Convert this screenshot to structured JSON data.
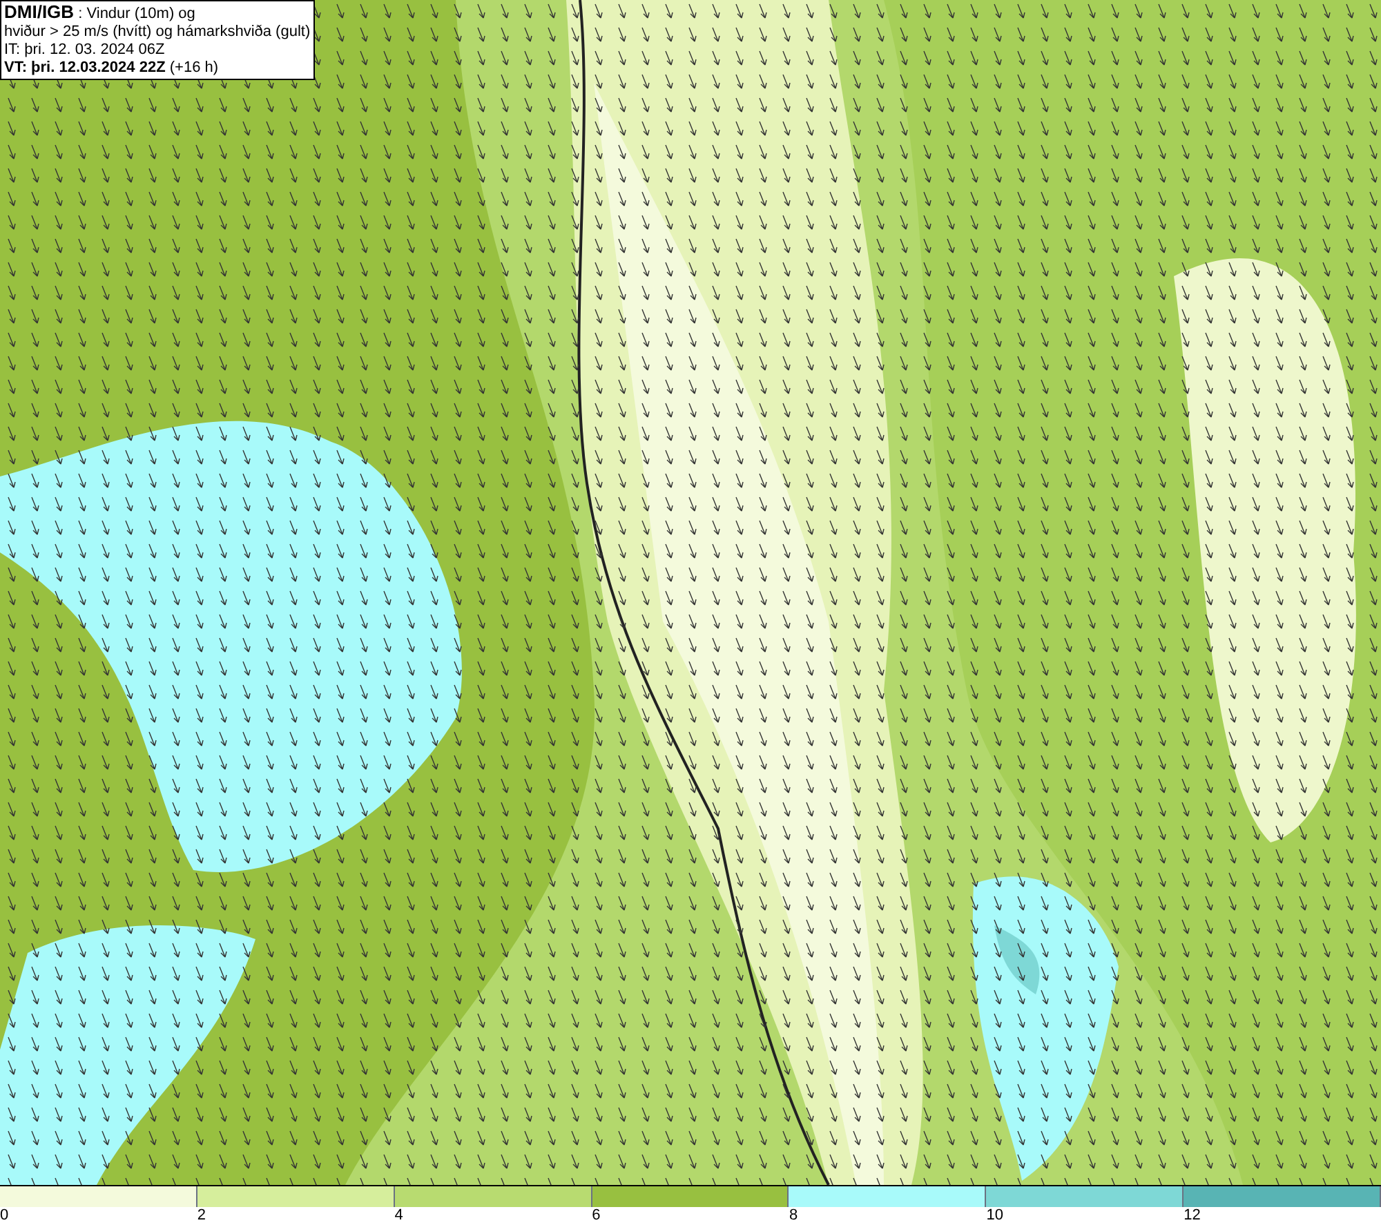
{
  "info_box": {
    "title_bold": "DMI/IGB",
    "title_rest": ": Vindur (10m) og",
    "line_2": "hviður > 25 m/s (hvítt) og hámarkshviða (gult)",
    "it_line": "IT: þri. 12. 03. 2024 06Z",
    "vt_bold": "VT: þri. 12.03.2024 22Z",
    "vt_rest": "(+16 h)"
  },
  "legend": [
    {
      "label": "0",
      "color": "#f4fadc"
    },
    {
      "label": "2",
      "color": "#d6ee9c"
    },
    {
      "label": "4",
      "color": "#b8db70"
    },
    {
      "label": "6",
      "color": "#98c040"
    },
    {
      "label": "8",
      "color": "#a8fafa"
    },
    {
      "label": "10",
      "color": "#7ed8d6"
    },
    {
      "label": "12",
      "color": "#58b4b4"
    }
  ]
}
